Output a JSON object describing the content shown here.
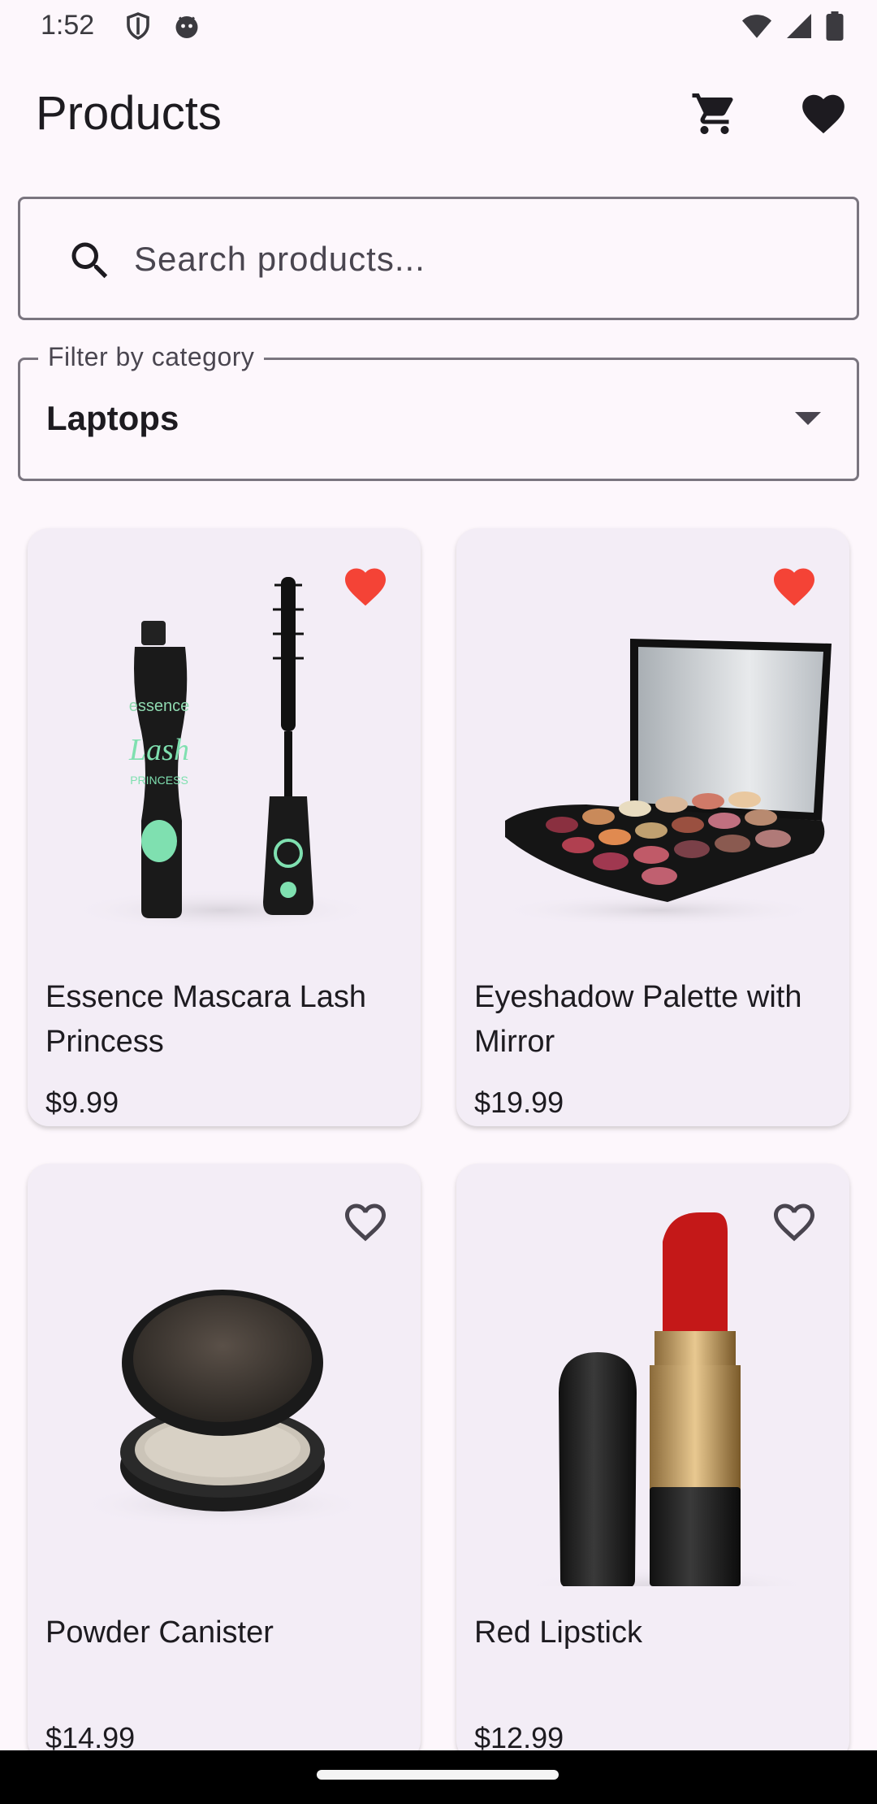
{
  "status": {
    "time": "1:52"
  },
  "app_bar": {
    "title": "Products",
    "cart_icon": "cart-icon",
    "favorites_icon": "heart-icon"
  },
  "search": {
    "placeholder": "Search products...",
    "value": ""
  },
  "category": {
    "label": "Filter by category",
    "selected": "Laptops"
  },
  "products": [
    {
      "name": "Essence Mascara Lash Princess",
      "price": "$9.99",
      "favorite": true
    },
    {
      "name": "Eyeshadow Palette with Mirror",
      "price": "$19.99",
      "favorite": true
    },
    {
      "name": "Powder Canister",
      "price": "$14.99",
      "favorite": false
    },
    {
      "name": "Red Lipstick",
      "price": "$12.99",
      "favorite": false
    }
  ],
  "colors": {
    "favorite_active": "#f44336",
    "favorite_inactive": "#49454f",
    "background": "#fdf7fc",
    "card": "#f3edf6"
  }
}
